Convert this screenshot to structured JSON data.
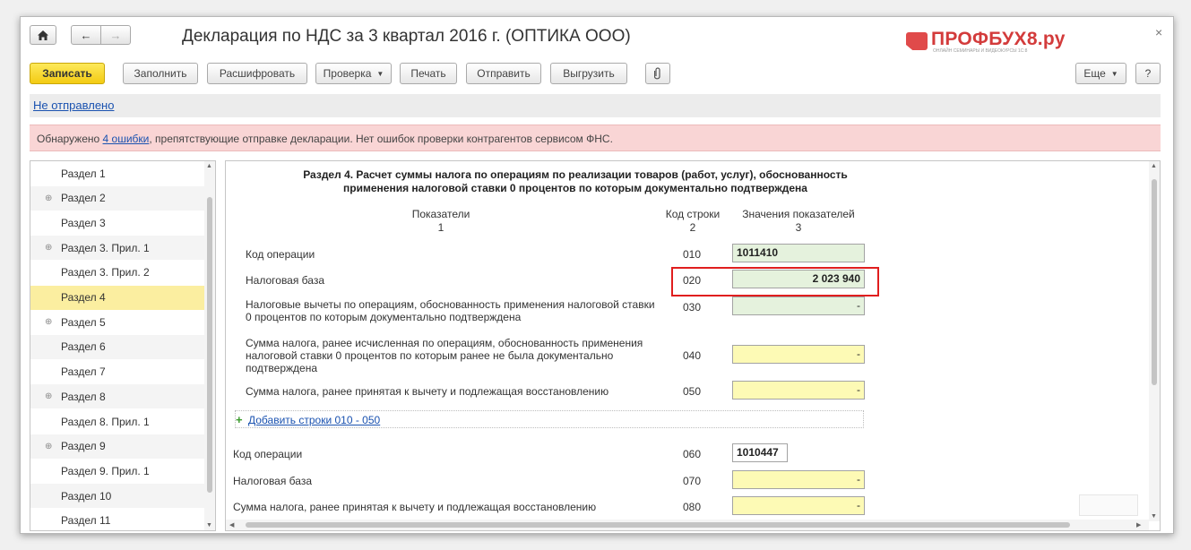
{
  "window": {
    "title": "Декларация по НДС за 3 квартал 2016 г. (ОПТИКА ООО)",
    "close_glyph": "×",
    "nav": {
      "home_icon": "home-icon",
      "back_glyph": "←",
      "forward_glyph": "→"
    }
  },
  "logo": {
    "text": "ПРОФБУХ8.ру",
    "tagline": "ОНЛАЙН СЕМИНАРЫ И ВИДЕОКУРСЫ 1С:8",
    "color": "#d33b3b"
  },
  "toolbar": {
    "save": "Записать",
    "fill": "Заполнить",
    "decode": "Расшифровать",
    "check": "Проверка",
    "print": "Печать",
    "send": "Отправить",
    "export": "Выгрузить",
    "attach_icon": "paperclip-icon",
    "more": "Еще",
    "help": "?"
  },
  "status": {
    "label": "Не отправлено"
  },
  "errors": {
    "prefix": "Обнаружено",
    "link": "4 ошибки",
    "suffix": ", препятствующие отправке декларации. Нет ошибок проверки контрагентов сервисом ФНС."
  },
  "sidebar": {
    "items": [
      {
        "label": "Раздел 1",
        "expandable": false
      },
      {
        "label": "Раздел 2",
        "expandable": true
      },
      {
        "label": "Раздел 3",
        "expandable": false
      },
      {
        "label": "Раздел 3. Прил. 1",
        "expandable": true
      },
      {
        "label": "Раздел 3. Прил. 2",
        "expandable": false
      },
      {
        "label": "Раздел 4",
        "expandable": false,
        "active": true
      },
      {
        "label": "Раздел 5",
        "expandable": true
      },
      {
        "label": "Раздел 6",
        "expandable": false
      },
      {
        "label": "Раздел 7",
        "expandable": false
      },
      {
        "label": "Раздел 8",
        "expandable": true
      },
      {
        "label": "Раздел 8. Прил. 1",
        "expandable": false
      },
      {
        "label": "Раздел 9",
        "expandable": true
      },
      {
        "label": "Раздел 9. Прил. 1",
        "expandable": false
      },
      {
        "label": "Раздел 10",
        "expandable": false
      },
      {
        "label": "Раздел 11",
        "expandable": false
      }
    ]
  },
  "form": {
    "heading_line1": "Раздел 4. Расчет суммы налога по операциям по реализации товаров (работ, услуг), обоснованность",
    "heading_line2": "применения налоговой ставки 0 процентов по которым документально подтверждена",
    "col1_title": "Показатели",
    "col1_num": "1",
    "col2_title": "Код строки",
    "col2_num": "2",
    "col3_title": "Значения показателей",
    "col3_num": "3",
    "rows": [
      {
        "label": "Код операции",
        "code": "010",
        "value": "1011410"
      },
      {
        "label": "Налоговая база",
        "code": "020",
        "value": "2 023 940"
      },
      {
        "label": "Налоговые вычеты по операциям, обоснованность применения налоговой ставки 0 процентов по которым документально подтверждена",
        "code": "030",
        "value": "-"
      },
      {
        "label": "Сумма налога, ранее исчисленная по операциям, обоснованность применения налоговой ставки 0 процентов по которым ранее не была документально подтверждена",
        "code": "040",
        "value": "-"
      },
      {
        "label": "Сумма налога, ранее принятая к вычету и подлежащая восстановлению",
        "code": "050",
        "value": "-"
      }
    ],
    "add_rows_label": "Добавить строки 010 - 050",
    "rows2": [
      {
        "label": "Код операции",
        "code": "060",
        "value": "1010447"
      },
      {
        "label": "Налоговая база",
        "code": "070",
        "value": "-"
      },
      {
        "label": "Сумма налога, ранее принятая к вычету и подлежащая восстановлению",
        "code": "080",
        "value": "-"
      }
    ]
  },
  "colors": {
    "save_button": "#f3cb13",
    "error_strip": "#f9d5d5",
    "active_section": "#fbeea0",
    "computed_field": "#e5f2dd",
    "editable_field": "#fdfab5",
    "highlight": "#e01e1e",
    "link": "#1a52b0"
  }
}
